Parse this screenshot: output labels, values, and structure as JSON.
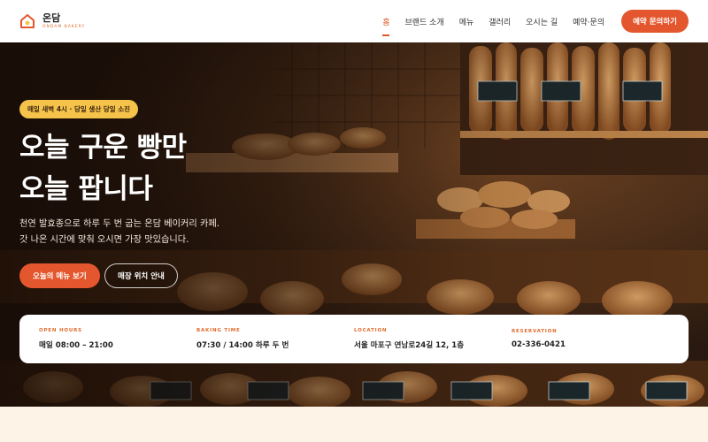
{
  "brand": {
    "name": "온담",
    "subtitle": "ONDAM BAKERY",
    "accent": "#e4572e"
  },
  "nav": {
    "items": [
      {
        "label": "홈",
        "active": true
      },
      {
        "label": "브랜드 소개",
        "active": false
      },
      {
        "label": "메뉴",
        "active": false
      },
      {
        "label": "갤러리",
        "active": false
      },
      {
        "label": "오시는 길",
        "active": false
      },
      {
        "label": "예약·문의",
        "active": false
      }
    ],
    "cta_label": "예약 문의하기"
  },
  "hero": {
    "badge": "매일 새벽 4시 · 당일 생산 당일 소진",
    "title_line1": "오늘 구운 빵만",
    "title_line2": "오늘 팝니다",
    "desc_line1": "천연 발효종으로 하루 두 번 굽는 온담 베이커리 카페.",
    "desc_line2": "갓 나온 시간에 맞춰 오시면 가장 맛있습니다.",
    "primary_button": "오늘의 메뉴 보기",
    "secondary_button": "매장 위치 안내"
  },
  "info": [
    {
      "label": "OPEN HOURS",
      "value": "매일 08:00 – 21:00"
    },
    {
      "label": "BAKING TIME",
      "value": "07:30 / 14:00 하루 두 번"
    },
    {
      "label": "LOCATION",
      "value": "서울 마포구 연남로24길 12, 1층"
    },
    {
      "label": "RESERVATION",
      "value": "02-336-0421"
    }
  ],
  "icons": {
    "logo": "house-bread-icon"
  }
}
